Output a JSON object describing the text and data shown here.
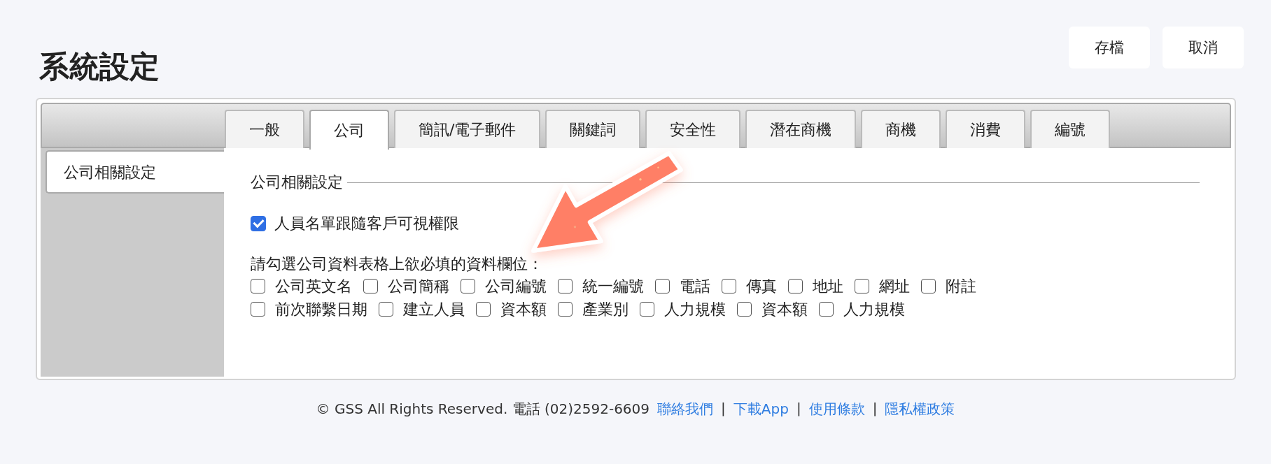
{
  "header": {
    "title": "系統設定",
    "buttons": [
      "存檔",
      "取消"
    ]
  },
  "tabs": [
    {
      "label": "一般",
      "selected": false
    },
    {
      "label": "公司",
      "selected": true
    },
    {
      "label": "簡訊/電子郵件",
      "selected": false
    },
    {
      "label": "關鍵詞",
      "selected": false
    },
    {
      "label": "安全性",
      "selected": false
    },
    {
      "label": "潛在商機",
      "selected": false
    },
    {
      "label": "商機",
      "selected": false
    },
    {
      "label": "消費",
      "selected": false
    },
    {
      "label": "編號",
      "selected": false
    }
  ],
  "sidebar": {
    "items": [
      {
        "label": "公司相關設定",
        "selected": true
      }
    ]
  },
  "section": {
    "legend": "公司相關設定",
    "options": [
      {
        "label": "人員名單跟隨客戶可視權限",
        "checked": true
      }
    ],
    "prompt": "請勾選公司資料表格上欲必填的資料欄位：",
    "field_rows": [
      {
        "fields": [
          {
            "label": "公司英文名",
            "checked": false
          },
          {
            "label": "公司簡稱",
            "checked": false
          },
          {
            "label": "公司編號",
            "checked": false
          },
          {
            "label": "統一編號",
            "checked": false
          },
          {
            "label": "電話",
            "checked": false
          },
          {
            "label": "傳真",
            "checked": false
          },
          {
            "label": "地址",
            "checked": false
          },
          {
            "label": "網址",
            "checked": false
          },
          {
            "label": "附註",
            "checked": false
          }
        ]
      },
      {
        "fields": [
          {
            "label": "前次聯繫日期",
            "checked": false
          },
          {
            "label": "建立人員",
            "checked": false
          },
          {
            "label": "資本額",
            "checked": false
          },
          {
            "label": "產業別",
            "checked": false
          },
          {
            "label": "人力規模",
            "checked": false
          },
          {
            "label": "資本額",
            "checked": false
          },
          {
            "label": "人力規模",
            "checked": false
          }
        ]
      }
    ]
  },
  "annotation": {
    "kind": "arrow"
  },
  "footer": {
    "items": [
      {
        "kind": "text",
        "text": "© GSS All Rights Reserved. 電話 (02)2592-6609"
      },
      {
        "kind": "link",
        "text": "聯絡我們"
      },
      {
        "kind": "separator",
        "text": "|"
      },
      {
        "kind": "link",
        "text": "下載App"
      },
      {
        "kind": "separator",
        "text": "|"
      },
      {
        "kind": "link",
        "text": "使用條款"
      },
      {
        "kind": "separator",
        "text": "|"
      },
      {
        "kind": "link",
        "text": "隱私權政策"
      }
    ]
  }
}
